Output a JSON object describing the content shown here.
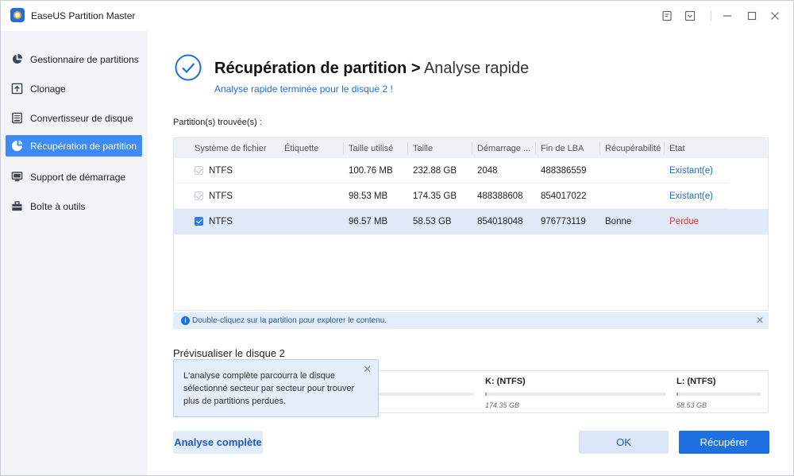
{
  "app": {
    "title": "EaseUS Partition Master"
  },
  "sidebar": {
    "items": [
      {
        "label": "Gestionnaire de partitions",
        "icon": "pie-chart-icon"
      },
      {
        "label": "Clonage",
        "icon": "clone-icon"
      },
      {
        "label": "Convertisseur de disque",
        "icon": "disk-convert-icon"
      },
      {
        "label": "Récupération de partition",
        "icon": "partition-recovery-icon",
        "active": true
      },
      {
        "label": "Support de démarrage",
        "icon": "boot-media-icon"
      },
      {
        "label": "Boîte à outils",
        "icon": "toolbox-icon"
      }
    ]
  },
  "header": {
    "title": "Récupération de partition",
    "separator": ">",
    "subtitle": "Analyse rapide",
    "status": "Analyse rapide terminée pour le disque 2 !"
  },
  "table": {
    "label": "Partition(s) trouvée(s) :",
    "columns": [
      "Système de fichier",
      "Étiquette",
      "Taille utilisé",
      "Taille",
      "Démarrage ...",
      "Fin de LBA",
      "Récupérabilité",
      "Etat"
    ],
    "rows": [
      {
        "fs": "NTFS",
        "label": "",
        "used": "100.76 MB",
        "size": "232.88 GB",
        "start": "2048",
        "end": "488386559",
        "recoverability": "",
        "state": "Existant(e)",
        "checked": false,
        "selected": false
      },
      {
        "fs": "NTFS",
        "label": "",
        "used": "98.53 MB",
        "size": "174.35 GB",
        "start": "488388608",
        "end": "854017022",
        "recoverability": "",
        "state": "Existant(e)",
        "checked": false,
        "selected": false
      },
      {
        "fs": "NTFS",
        "label": "",
        "used": "96.57 MB",
        "size": "58.53 GB",
        "start": "854018048",
        "end": "976773119",
        "recoverability": "Bonne",
        "state": "Perdue",
        "checked": true,
        "selected": true
      }
    ]
  },
  "info": {
    "text": "Double-cliquez sur la partition pour explorer le contenu."
  },
  "preview": {
    "label": "Prévisualiser le disque 2",
    "segments": [
      {
        "name": "K: (NTFS)",
        "size": "174.35 GB"
      },
      {
        "name": "L: (NTFS)",
        "size": "58.53 GB"
      }
    ]
  },
  "tooltip": {
    "text": "L'analyse complète parcourra le disque sélectionné secteur par secteur pour trouver plus de partitions perdues."
  },
  "buttons": {
    "full_scan": "Analyse complète",
    "ok": "OK",
    "recover": "Récupérer"
  },
  "colors": {
    "accent": "#1e6fe0",
    "active_nav": "#3e8bf5",
    "lost": "#e53935"
  }
}
